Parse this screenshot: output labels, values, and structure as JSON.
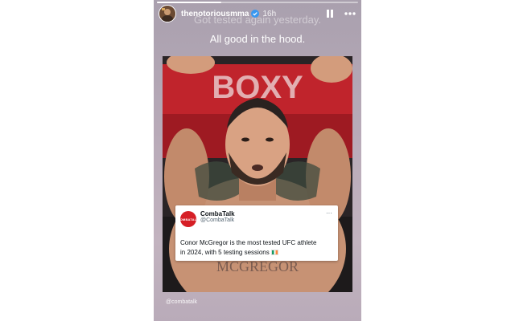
{
  "story": {
    "username": "thenotoriousmma",
    "time": "16h",
    "progress": 0.32,
    "caption_line1": "Got tested again yesterday.",
    "caption_line2": "All good in the hood.",
    "mention": "@combatalk",
    "photo_banner_text": "BOXY"
  },
  "tweet": {
    "logo_text": "COMBATALK",
    "name": "CombaTalk",
    "handle": "@CombaTalk",
    "more": "···",
    "text_line1": "Conor McGregor is the most tested UFC athlete",
    "text_line2": "in 2024, with 5 testing sessions"
  },
  "icons": [
    "avatar-image",
    "verified-badge-icon",
    "pause-icon",
    "more-options-icon",
    "ireland-flag-icon"
  ],
  "colors": {
    "accent_red": "#d61f26",
    "verified_blue": "#3897f0"
  }
}
